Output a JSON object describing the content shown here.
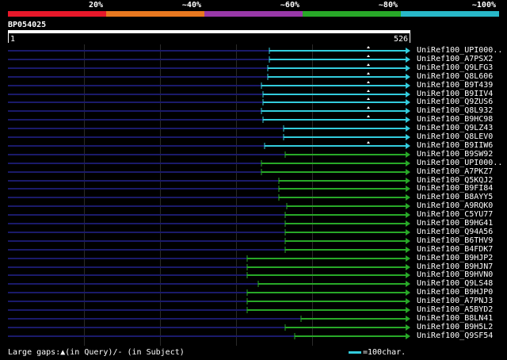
{
  "legend": {
    "segments": [
      {
        "label": "20%",
        "color": "#e8182a"
      },
      {
        "label": "~40%",
        "color": "#e87820"
      },
      {
        "label": "~60%",
        "color": "#9838a8"
      },
      {
        "label": "~80%",
        "color": "#28a828"
      },
      {
        "label": "~100%",
        "color": "#28b8c8"
      }
    ]
  },
  "query": {
    "id": "BP054025",
    "start": "1",
    "end": "526"
  },
  "hits": [
    {
      "label": "UniRef100_UPI000..",
      "color": "#33ccdd",
      "start": 340,
      "gap": 455
    },
    {
      "label": "UniRef100_A7PSX2",
      "color": "#33ccdd",
      "start": 340,
      "gap": 455
    },
    {
      "label": "UniRef100_Q9LFG3",
      "color": "#33ccdd",
      "start": 338,
      "gap": 455
    },
    {
      "label": "UniRef100_Q8L606",
      "color": "#33ccdd",
      "start": 338,
      "gap": 455
    },
    {
      "label": "UniRef100_B9T439",
      "color": "#33ccdd",
      "start": 330,
      "gap": 455
    },
    {
      "label": "UniRef100_B9IIV4",
      "color": "#33ccdd",
      "start": 332,
      "gap": 455
    },
    {
      "label": "UniRef100_Q9ZUS6",
      "color": "#33ccdd",
      "start": 332,
      "gap": 455
    },
    {
      "label": "UniRef100_Q8L932",
      "color": "#33ccdd",
      "start": 330,
      "gap": 455
    },
    {
      "label": "UniRef100_B9HC98",
      "color": "#33ccdd",
      "start": 332,
      "gap": 455
    },
    {
      "label": "UniRef100_Q9LZ43",
      "color": "#33ccdd",
      "start": 358,
      "gap": null
    },
    {
      "label": "UniRef100_Q8LEV0",
      "color": "#33ccdd",
      "start": 358,
      "gap": null
    },
    {
      "label": "UniRef100_B9IIW6",
      "color": "#33ccdd",
      "start": 334,
      "gap": 455
    },
    {
      "label": "UniRef100_B9SW92",
      "color": "#28a828",
      "start": 360,
      "gap": null
    },
    {
      "label": "UniRef100_UPI000..",
      "color": "#28a828",
      "start": 330,
      "gap": null
    },
    {
      "label": "UniRef100_A7PKZ7",
      "color": "#28a828",
      "start": 330,
      "gap": null
    },
    {
      "label": "UniRef100_Q5KQJ2",
      "color": "#28a828",
      "start": 352,
      "gap": null
    },
    {
      "label": "UniRef100_B9FI84",
      "color": "#28a828",
      "start": 352,
      "gap": null
    },
    {
      "label": "UniRef100_B8AYY5",
      "color": "#28a828",
      "start": 352,
      "gap": null
    },
    {
      "label": "UniRef100_A9RQK0",
      "color": "#28a828",
      "start": 362,
      "gap": null
    },
    {
      "label": "UniRef100_C5YU77",
      "color": "#28a828",
      "start": 360,
      "gap": null
    },
    {
      "label": "UniRef100_B9HG41",
      "color": "#28a828",
      "start": 360,
      "gap": null
    },
    {
      "label": "UniRef100_Q94A56",
      "color": "#28a828",
      "start": 360,
      "gap": null
    },
    {
      "label": "UniRef100_B6THV9",
      "color": "#28a828",
      "start": 360,
      "gap": null
    },
    {
      "label": "UniRef100_B4FDK7",
      "color": "#28a828",
      "start": 360,
      "gap": null
    },
    {
      "label": "UniRef100_B9HJP2",
      "color": "#28a828",
      "start": 312,
      "gap": null
    },
    {
      "label": "UniRef100_B9HJN7",
      "color": "#28a828",
      "start": 312,
      "gap": null
    },
    {
      "label": "UniRef100_B9HVN0",
      "color": "#28a828",
      "start": 312,
      "gap": null
    },
    {
      "label": "UniRef100_Q9LS48",
      "color": "#28a828",
      "start": 326,
      "gap": null
    },
    {
      "label": "UniRef100_B9HJP0",
      "color": "#28a828",
      "start": 312,
      "gap": null
    },
    {
      "label": "UniRef100_A7PNJ3",
      "color": "#28a828",
      "start": 312,
      "gap": null
    },
    {
      "label": "UniRef100_A5BYD2",
      "color": "#28a828",
      "start": 312,
      "gap": null
    },
    {
      "label": "UniRef100_B8LN41",
      "color": "#28a828",
      "start": 380,
      "gap": null
    },
    {
      "label": "UniRef100_B9H5L2",
      "color": "#28a828",
      "start": 360,
      "gap": null
    },
    {
      "label": "UniRef100_Q9SF54",
      "color": "#28a828",
      "start": 372,
      "gap": null
    }
  ],
  "footer": {
    "gaps_text": "Large gaps:▲(in Query)/‐ (in Subject)",
    "scale_text": "=100char."
  }
}
